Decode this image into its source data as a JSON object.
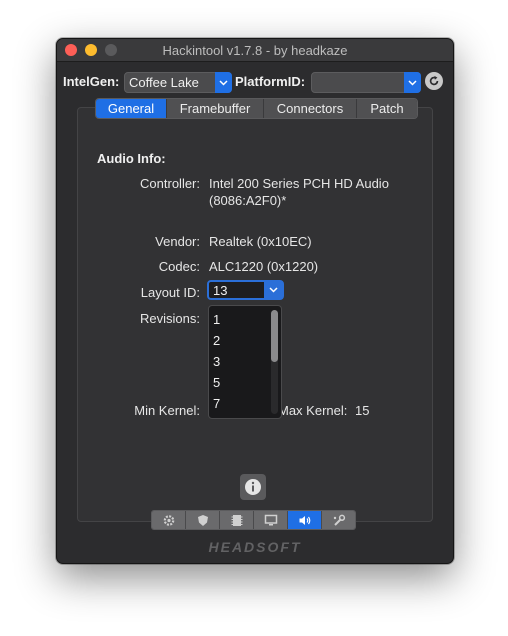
{
  "window": {
    "title": "Hackintool v1.7.8 - by headkaze"
  },
  "top_bar": {
    "intelgen_label": "IntelGen:",
    "intelgen_value": "Coffee Lake",
    "platformid_label": "PlatformID:",
    "platformid_value": ""
  },
  "tabs": [
    {
      "label": "General",
      "active": true
    },
    {
      "label": "Framebuffer",
      "active": false
    },
    {
      "label": "Connectors",
      "active": false
    },
    {
      "label": "Patch",
      "active": false
    }
  ],
  "audio": {
    "section_title": "Audio Info:",
    "controller_label": "Controller:",
    "controller_value_line1": "Intel 200 Series PCH HD Audio",
    "controller_value_line2": "(8086:A2F0)*",
    "vendor_label": "Vendor:",
    "vendor_value": "Realtek (0x10EC)",
    "codec_label": "Codec:",
    "codec_value": "ALC1220 (0x1220)",
    "layout_label": "Layout ID:",
    "layout_value": "13",
    "revisions_label": "Revisions:",
    "min_kernel_label": "Min Kernel:",
    "max_kernel_label": "Max Kernel:",
    "max_kernel_value": "15"
  },
  "layout_options": [
    "1",
    "2",
    "3",
    "5",
    "7"
  ],
  "toolbar": {
    "icons": [
      "gear-icon",
      "shield-icon",
      "memory-icon",
      "monitor-icon",
      "speaker-icon",
      "wrench-icon"
    ],
    "active_index": 4
  },
  "brand": "HEADSOFT",
  "colors": {
    "accent": "#1f6fe5",
    "window_bg": "#2c2c2e"
  }
}
